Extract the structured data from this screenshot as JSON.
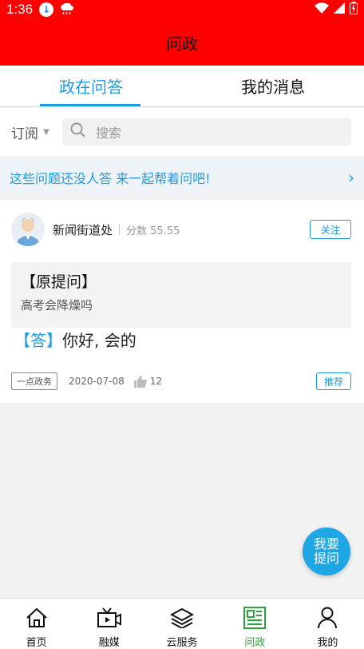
{
  "status_bar": {
    "time": "1:36"
  },
  "app_bar": {
    "title": "问政"
  },
  "tabs": [
    {
      "label": "政在问答",
      "active": true
    },
    {
      "label": "我的消息",
      "active": false
    }
  ],
  "filter": {
    "subscribe_label": "订阅",
    "search_placeholder": "搜索"
  },
  "banner": {
    "text": "这些问题还没人答 来一起帮着问吧!"
  },
  "post": {
    "author": "新闻街道处",
    "score": "分数 55.55",
    "follow_label": "关注",
    "question_title": "【原提问】",
    "question_text": "高考会降燥吗",
    "answer_tag": "【答】",
    "answer_text": "你好, 会的",
    "source": "一点政务",
    "date": "2020-07-08",
    "likes": "12",
    "recommend_label": "推荐"
  },
  "fab": {
    "label": "我要提问"
  },
  "bottom_nav": [
    {
      "label": "首页",
      "icon": "home-icon",
      "active": false
    },
    {
      "label": "融媒",
      "icon": "tv-icon",
      "active": false
    },
    {
      "label": "云服务",
      "icon": "layers-icon",
      "active": false
    },
    {
      "label": "问政",
      "icon": "newspaper-icon",
      "active": true
    },
    {
      "label": "我的",
      "icon": "person-icon",
      "active": false
    }
  ],
  "colors": {
    "accent": "#1c9be6",
    "header": "#ff0000",
    "nav_active": "#2aa53a"
  }
}
